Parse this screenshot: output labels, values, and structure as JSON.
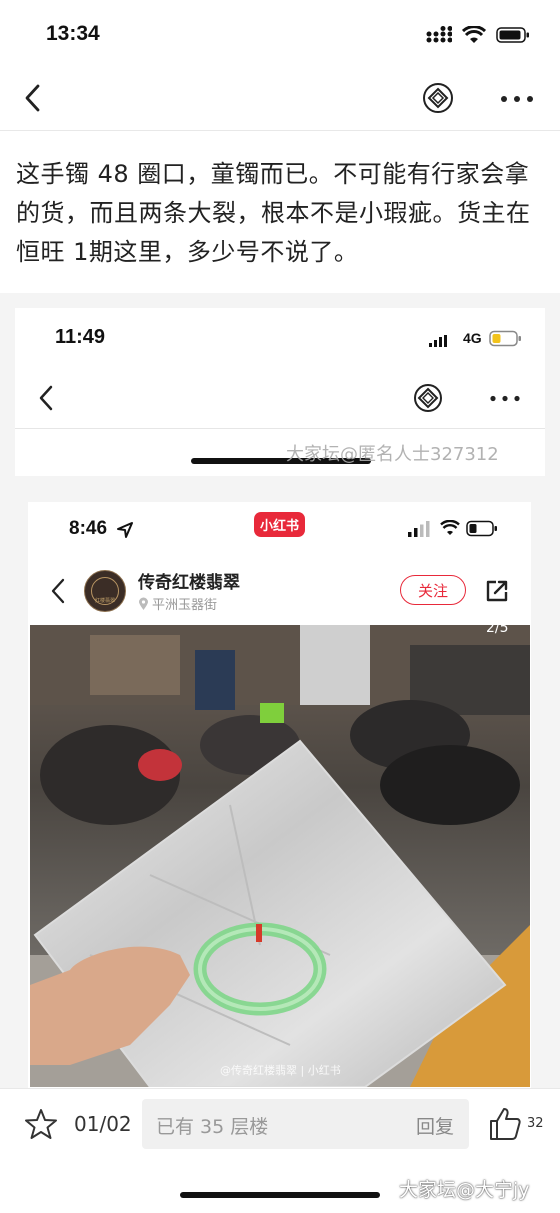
{
  "status_bar": {
    "time": "13:34"
  },
  "post": {
    "text": "这手镯 48 圈口，童镯而已。不可能有行家会拿的货，而且两条大裂，根本不是小瑕疵。货主在恒旺 1期这里，多少号不说了。"
  },
  "embedded_screenshot_1": {
    "time": "11:49",
    "network": "4G",
    "watermark": "大家坛@匿名人士327312"
  },
  "embedded_screenshot_2": {
    "time": "8:46",
    "app_badge": "小红书",
    "shop_name": "传奇红楼翡翠",
    "location": "平洲玉器街",
    "follow_label": "关注",
    "image_counter": "2/5",
    "image_watermark": "@传奇红楼翡翠 | 小红书",
    "avatar_text": "红楼翡翠"
  },
  "bottom_bar": {
    "page_indicator": "01/02",
    "reply_placeholder": "已有 35 层楼",
    "reply_button": "回复",
    "like_count": "32"
  },
  "watermark": "大家坛@大宁jy",
  "colors": {
    "accent_red": "#e8293a",
    "jade_green": "#7fd68a"
  }
}
